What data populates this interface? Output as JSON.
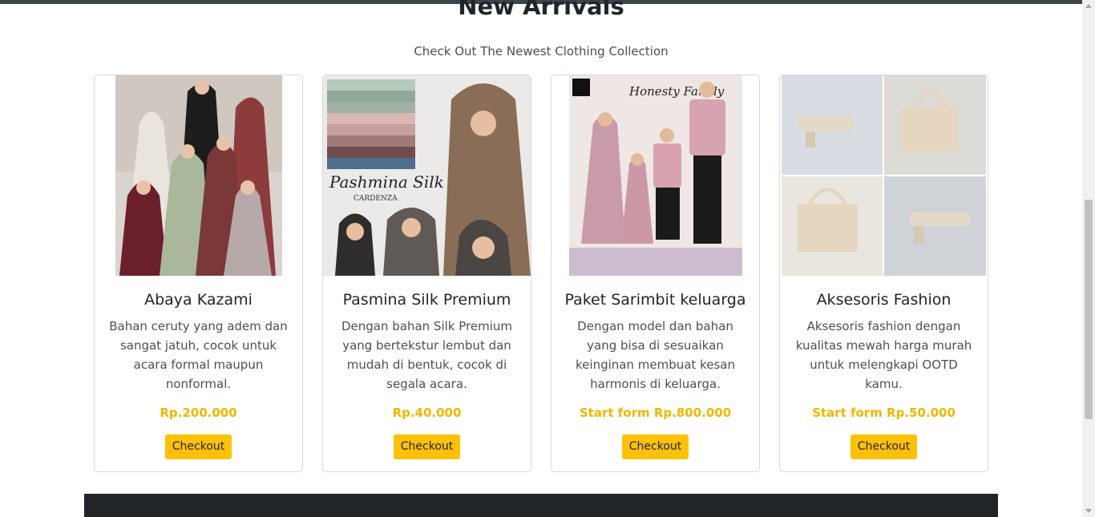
{
  "section": {
    "title": "New Arrivals",
    "subtitle": "Check Out The Newest Clothing Collection"
  },
  "products": [
    {
      "name": "Abaya Kazami",
      "description": "Bahan ceruty yang adem dan sangat jatuh, cocok untuk acara formal maupun nonformal.",
      "price": "Rp.200.000",
      "button": "Checkout",
      "image_icon": "abaya-photo"
    },
    {
      "name": "Pasmina Silk Premium",
      "description": "Dengan bahan Silk Premium yang bertekstur lembut dan mudah di bentuk, cocok di segala acara.",
      "price": "Rp.40.000",
      "button": "Checkout",
      "image_icon": "hijab-photo",
      "image_caption": "Pashmina Silk",
      "image_brand": "CARDENZA"
    },
    {
      "name": "Paket Sarimbit keluarga",
      "description": "Dengan model dan bahan yang bisa di sesuaikan keinginan membuat kesan harmonis di keluarga.",
      "price": "Start form Rp.800.000",
      "button": "Checkout",
      "image_icon": "family-outfit-photo",
      "image_caption": "Honesty Family"
    },
    {
      "name": "Aksesoris Fashion",
      "description": "Aksesoris fashion dengan kualitas mewah harga murah untuk melengkapi OOTD kamu.",
      "price": "Start form Rp.50.000",
      "button": "Checkout",
      "image_icon": "bag-shoes-photo"
    }
  ],
  "colors": {
    "accent": "#ffc107",
    "price": "#f2b600",
    "footer": "#212529"
  }
}
